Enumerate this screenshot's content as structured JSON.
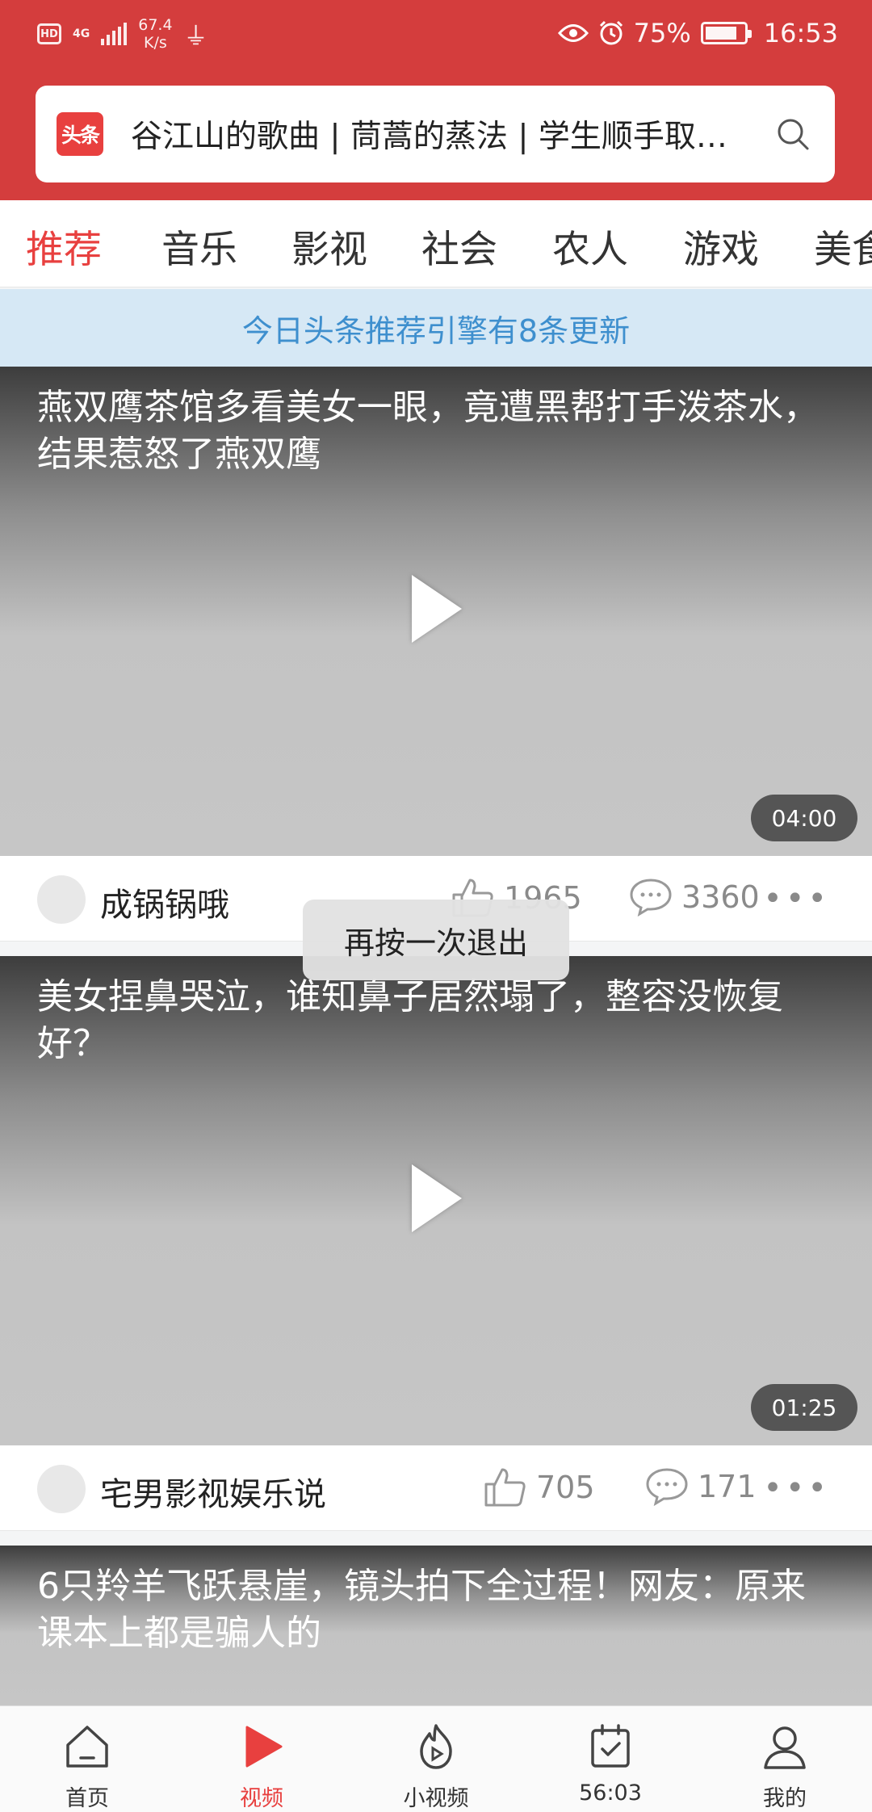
{
  "status_bar": {
    "network_badge": "HD",
    "signal_type": "4G",
    "speed": "67.4",
    "speed_unit": "K/s",
    "battery": "75%",
    "time": "16:53"
  },
  "search": {
    "logo_text": "头条",
    "placeholder": "谷江山的歌曲 | 茼蒿的蒸法 | 学生顺手取…"
  },
  "tabs": [
    "推荐",
    "音乐",
    "影视",
    "社会",
    "农人",
    "游戏",
    "美食"
  ],
  "banner": {
    "text": "今日头条推荐引擎有8条更新"
  },
  "videos": [
    {
      "title": "燕双鹰茶馆多看美女一眼，竟遭黑帮打手泼茶水，结果惹怒了燕双鹰",
      "duration": "04:00",
      "author": "成锅锅哦",
      "likes": "1965",
      "comments": "3360"
    },
    {
      "title": "美女捏鼻哭泣，谁知鼻子居然塌了，整容没恢复好？",
      "duration": "01:25",
      "author": "宅男影视娱乐说",
      "likes": "705",
      "comments": "171"
    },
    {
      "title": "6只羚羊飞跃悬崖，镜头拍下全过程！网友：原来课本上都是骗人的"
    }
  ],
  "toast": {
    "text": "再按一次退出"
  },
  "bottom_nav": [
    {
      "label": "首页",
      "icon": "home-icon"
    },
    {
      "label": "视频",
      "icon": "video-play-icon"
    },
    {
      "label": "小视频",
      "icon": "short-video-icon"
    },
    {
      "label": "56:03",
      "icon": "task-calendar-icon"
    },
    {
      "label": "我的",
      "icon": "profile-icon"
    }
  ],
  "colors": {
    "brand_red": "#d43d3d",
    "active_red": "#e8403f",
    "banner_bg": "#d6e8f5",
    "banner_text": "#3e8fce"
  }
}
